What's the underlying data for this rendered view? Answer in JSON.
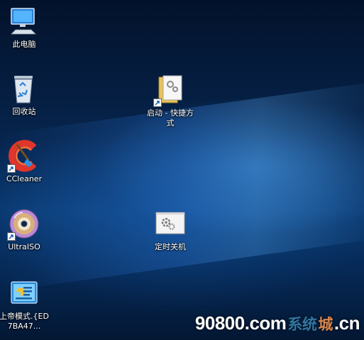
{
  "desktop": {
    "icons": [
      {
        "label": "此电脑",
        "icon": "computer-icon"
      },
      {
        "label": "回收站",
        "icon": "recycle-bin-icon"
      },
      {
        "label": "CCleaner",
        "icon": "ccleaner-icon",
        "shortcut": true
      },
      {
        "label": "UltraISO",
        "icon": "disc-icon",
        "shortcut": true
      },
      {
        "label": "上帝模式.{ED7BA47...",
        "icon": "control-panel-icon"
      },
      {
        "label": "启动 - 快捷方式",
        "icon": "folder-icon",
        "shortcut": true
      },
      {
        "label": "定时关机",
        "icon": "gear-window-icon"
      }
    ]
  },
  "watermark": {
    "site_part1": "90800",
    "site_part2": ".com",
    "site_part3": ".cn",
    "overlay_part1": "系统",
    "overlay_part2": "城"
  },
  "colors": {
    "background_dark": "#03122b",
    "background_light": "#0a3a72",
    "watermark_orange": "#ff9a52",
    "watermark_blue": "#59c0f0"
  }
}
